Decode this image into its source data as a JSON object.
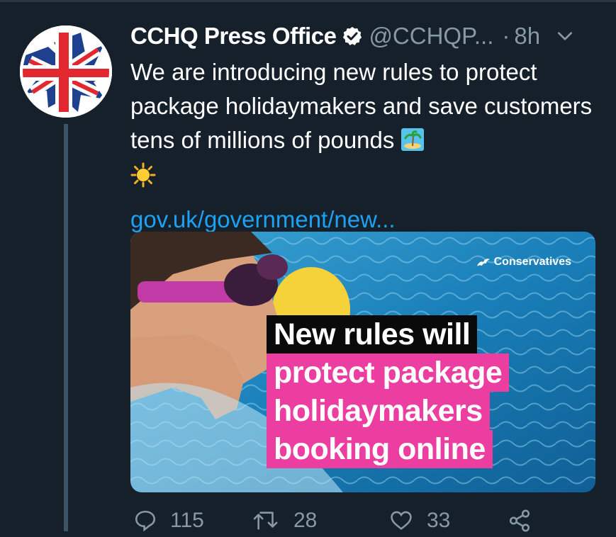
{
  "tweet": {
    "display_name": "CCHQ Press Office",
    "handle": "@CCHQP...",
    "separator": "·",
    "time": "8h",
    "text": "We are introducing new rules to protect package holidaymakers and save customers tens of millions of pounds",
    "emoji_1": "🏝️",
    "emoji_2": "☀️",
    "link": "gov.uk/government/new..."
  },
  "media": {
    "brand": "Conservatives",
    "headline_black": "New rules will",
    "headline_pink": [
      "protect package",
      "holidaymakers",
      "booking online"
    ]
  },
  "actions": {
    "replies": "115",
    "retweets": "28",
    "likes": "33"
  },
  "colors": {
    "background": "#15202b",
    "link": "#1da1f2",
    "muted": "#8899a6",
    "pink": "#ec3ea0"
  },
  "icons": [
    "verified-badge-icon",
    "chevron-down-icon",
    "reply-icon",
    "retweet-icon",
    "like-icon",
    "share-icon",
    "conservatives-tree-logo"
  ]
}
